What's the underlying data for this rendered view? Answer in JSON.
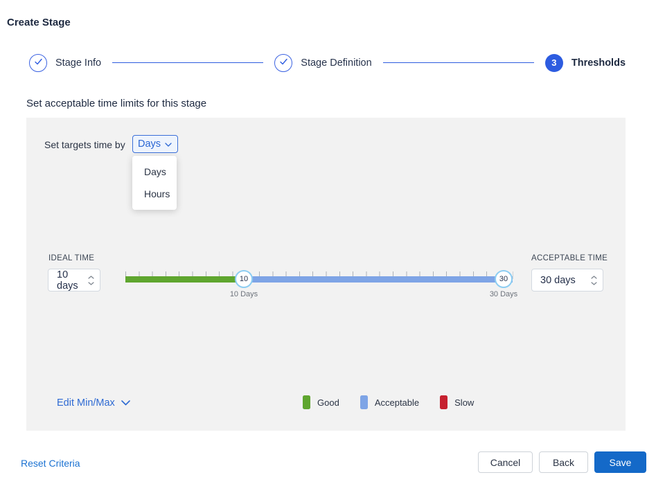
{
  "title": "Create Stage",
  "stepper": {
    "steps": [
      {
        "label": "Stage Info",
        "state": "complete"
      },
      {
        "label": "Stage Definition",
        "state": "complete"
      },
      {
        "label": "Thresholds",
        "state": "current",
        "number": "3"
      }
    ]
  },
  "heading": "Set acceptable time limits for this stage",
  "targets": {
    "label": "Set targets time by",
    "selected": "Days",
    "options": [
      "Days",
      "Hours"
    ]
  },
  "ideal": {
    "label": "IDEAL TIME",
    "value": "10 days"
  },
  "acceptable": {
    "label": "ACCEPTABLE TIME",
    "value": "30 days"
  },
  "slider": {
    "min_handle": {
      "value": "10",
      "caption": "10 Days"
    },
    "max_handle": {
      "value": "30",
      "caption": "30 Days"
    }
  },
  "legend": [
    {
      "label": "Good",
      "color": "#5fa62f"
    },
    {
      "label": "Acceptable",
      "color": "#7ea4e6"
    },
    {
      "label": "Slow",
      "color": "#c6212f"
    }
  ],
  "edit_minmax_label": "Edit Min/Max",
  "footer": {
    "reset_label": "Reset Criteria",
    "cancel_label": "Cancel",
    "back_label": "Back",
    "save_label": "Save"
  },
  "icons": {
    "step_check": "check-icon",
    "dropdown_caret": "chevron-down-icon",
    "stepper_up": "chevron-up-icon",
    "stepper_down": "chevron-down-icon"
  },
  "colors": {
    "stepper_blue": "#2d5ce0",
    "link_blue": "#2e6ad3",
    "save_blue": "#1469c8",
    "slider_green": "#5fa62f",
    "slider_blue": "#7ea4e6",
    "handle_ring": "#8dcdf2",
    "panel_gray": "#f2f2f2"
  }
}
